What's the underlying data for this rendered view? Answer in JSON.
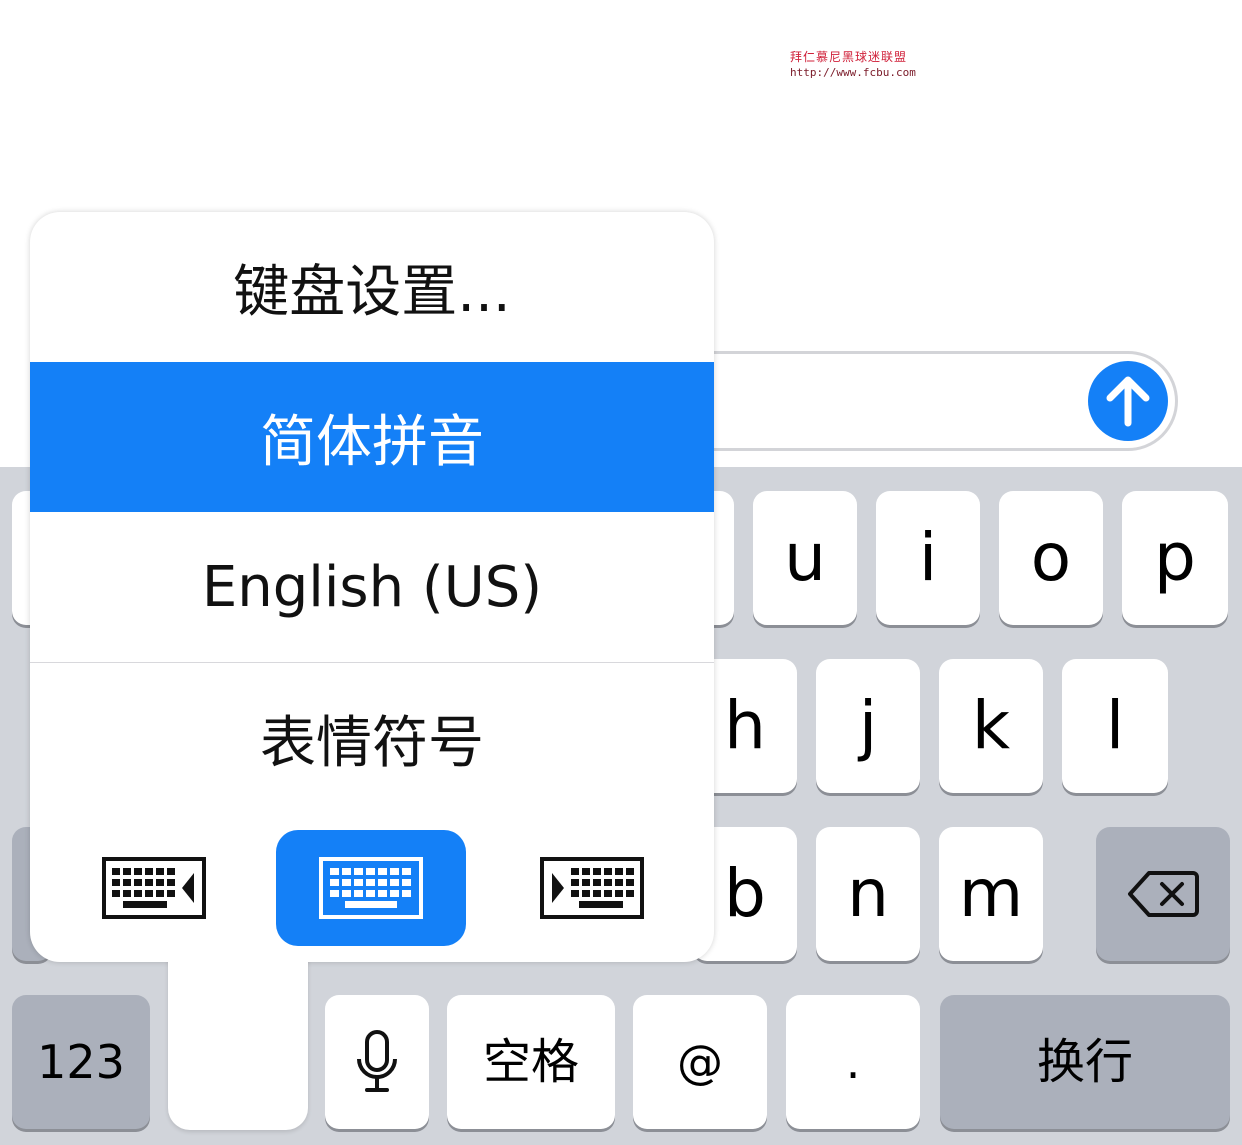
{
  "watermark": {
    "line1": "拜仁慕尼黑球迷联盟",
    "line2": "http://www.fcbu.com"
  },
  "menu": {
    "items": [
      {
        "label": "键盘设置...",
        "selected": false
      },
      {
        "label": "简体拼音",
        "selected": true
      },
      {
        "label": "English (US)",
        "selected": false
      },
      {
        "label": "表情符号",
        "selected": false
      }
    ],
    "modes": [
      {
        "icon": "keyboard-left-handed-icon",
        "active": false
      },
      {
        "icon": "keyboard-full-icon",
        "active": true
      },
      {
        "icon": "keyboard-right-handed-icon",
        "active": false
      }
    ]
  },
  "keyboard": {
    "row1": [
      "u",
      "i",
      "o",
      "p"
    ],
    "row2": [
      "h",
      "j",
      "k",
      "l"
    ],
    "row3": [
      "b",
      "n",
      "m"
    ],
    "bottom": {
      "numbers": "123",
      "space": "空格",
      "at": "@",
      "period": ".",
      "return": "换行"
    },
    "icons": {
      "delete": "delete-icon",
      "mic": "microphone-icon",
      "send": "send-arrow-icon"
    }
  },
  "colors": {
    "accent": "#1480f7",
    "keyboard_bg": "#d1d4da",
    "func_key": "#abb0bb"
  }
}
